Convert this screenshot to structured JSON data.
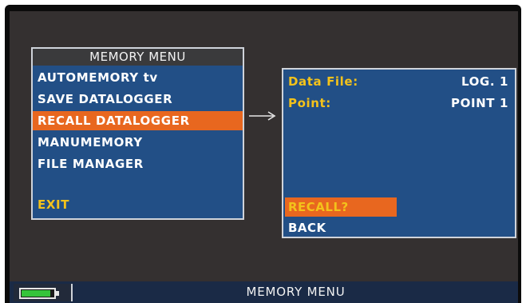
{
  "memory_menu": {
    "title": "MEMORY MENU",
    "items": [
      {
        "label": "AUTOMEMORY tv"
      },
      {
        "label": "SAVE DATALOGGER"
      },
      {
        "label": "RECALL DATALOGGER"
      },
      {
        "label": "MANUMEMORY"
      },
      {
        "label": "FILE MANAGER"
      }
    ],
    "selected_item": "RECALL DATALOGGER",
    "exit_label": "EXIT"
  },
  "recall_panel": {
    "data_file_label": "Data File:",
    "data_file_value": "LOG. 1",
    "point_label": "Point:",
    "point_value": "POINT 1",
    "recall_label": "RECALL?",
    "back_label": "BACK"
  },
  "status_bar": {
    "title": "MEMORY MENU",
    "battery_level": 0.9
  },
  "colors": {
    "menu_background": "#224f86",
    "highlight": "#e8671f",
    "label_yellow": "#f3c21b",
    "screen_background": "#343030",
    "battery_green": "#36c43a"
  }
}
